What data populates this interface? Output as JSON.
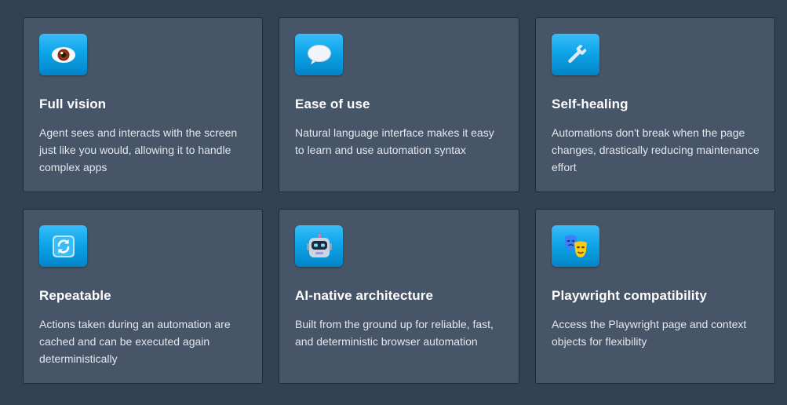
{
  "features": [
    {
      "icon": "eye-icon",
      "title": "Full vision",
      "description": "Agent sees and interacts with the screen just like you would, allowing it to handle complex apps"
    },
    {
      "icon": "speech-bubble-icon",
      "title": "Ease of use",
      "description": "Natural language interface makes it easy to learn and use automation syntax"
    },
    {
      "icon": "wrench-icon",
      "title": "Self-healing",
      "description": "Automations don't break when the page changes, drastically reducing maintenance effort"
    },
    {
      "icon": "repeat-arrows-icon",
      "title": "Repeatable",
      "description": "Actions taken during an automation are cached and can be executed again deterministically"
    },
    {
      "icon": "robot-icon",
      "title": "AI-native architecture",
      "description": "Built from the ground up for reliable, fast, and deterministic browser automation"
    },
    {
      "icon": "theater-masks-icon",
      "title": "Playwright compatibility",
      "description": "Access the Playwright page and context objects for flexibility"
    }
  ],
  "colors": {
    "background": "#334155",
    "card": "#475569",
    "icon_accent": "#0ea5e9"
  }
}
